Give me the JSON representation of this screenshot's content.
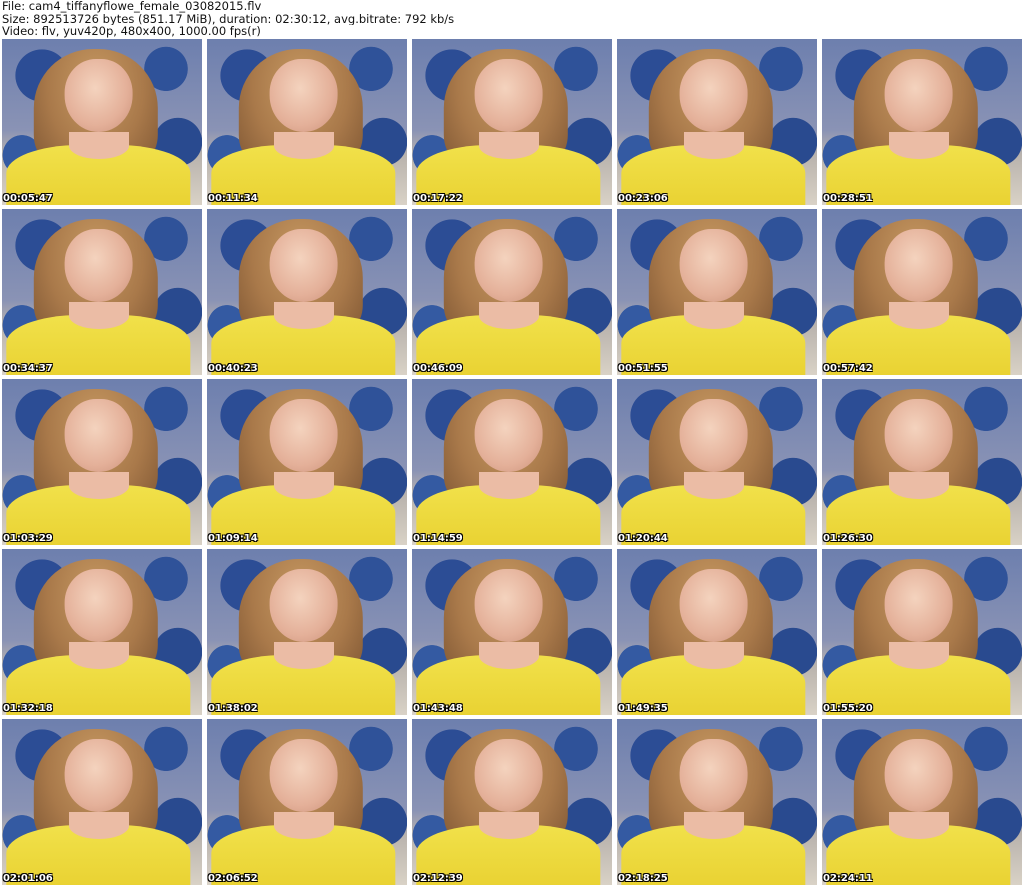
{
  "header": {
    "line1": "File: cam4_tiffanyflowe_female_03082015.flv",
    "line2": "Size: 892513726 bytes (851.17 MiB), duration: 02:30:12, avg.bitrate: 792 kb/s",
    "line3": "Video: flv, yuv420p, 480x400, 1000.00 fps(r)"
  },
  "thumbnails": [
    {
      "time": "00:05:47"
    },
    {
      "time": "00:11:34"
    },
    {
      "time": "00:17:22"
    },
    {
      "time": "00:23:06"
    },
    {
      "time": "00:28:51"
    },
    {
      "time": "00:34:37"
    },
    {
      "time": "00:40:23"
    },
    {
      "time": "00:46:09"
    },
    {
      "time": "00:51:55"
    },
    {
      "time": "00:57:42"
    },
    {
      "time": "01:03:29"
    },
    {
      "time": "01:09:14"
    },
    {
      "time": "01:14:59"
    },
    {
      "time": "01:20:44"
    },
    {
      "time": "01:26:30"
    },
    {
      "time": "01:32:18"
    },
    {
      "time": "01:38:02"
    },
    {
      "time": "01:43:48"
    },
    {
      "time": "01:49:35"
    },
    {
      "time": "01:55:20"
    },
    {
      "time": "02:01:06"
    },
    {
      "time": "02:06:52"
    },
    {
      "time": "02:12:39"
    },
    {
      "time": "02:18:25"
    },
    {
      "time": "02:24:11"
    }
  ]
}
